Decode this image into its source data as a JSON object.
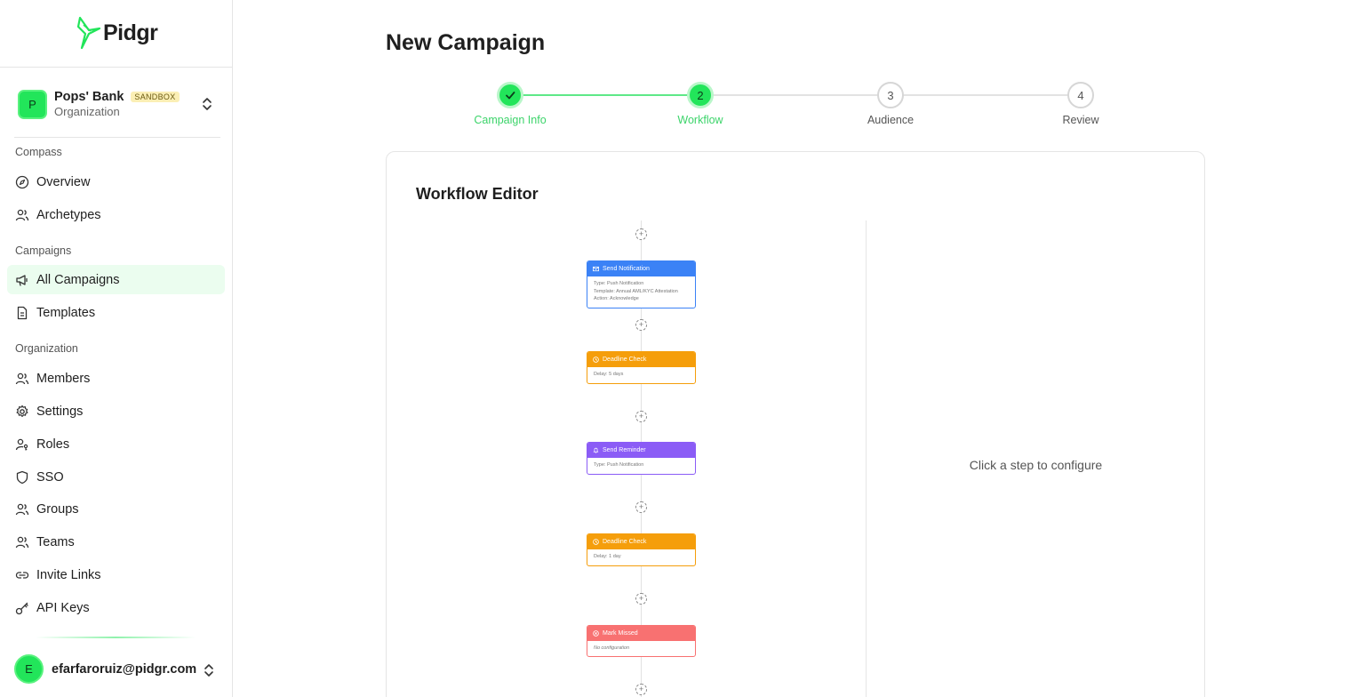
{
  "brand": {
    "name": "Pidgr",
    "accent": "#22e55a"
  },
  "org": {
    "avatar": "P",
    "name": "Pops' Bank",
    "badge": "SANDBOX",
    "type": "Organization"
  },
  "sidebar": {
    "compass_label": "Compass",
    "compass_items": [
      {
        "label": "Overview",
        "icon": "compass-icon"
      },
      {
        "label": "Archetypes",
        "icon": "users-icon"
      }
    ],
    "campaigns_label": "Campaigns",
    "campaign_items": [
      {
        "label": "All Campaigns",
        "icon": "megaphone-icon",
        "active": true
      },
      {
        "label": "Templates",
        "icon": "document-icon"
      }
    ],
    "organization_label": "Organization",
    "organization_items": [
      {
        "label": "Members",
        "icon": "users-icon"
      },
      {
        "label": "Settings",
        "icon": "gear-icon"
      },
      {
        "label": "Roles",
        "icon": "user-key-icon"
      },
      {
        "label": "SSO",
        "icon": "shield-icon"
      },
      {
        "label": "Groups",
        "icon": "users-icon"
      },
      {
        "label": "Teams",
        "icon": "users-icon"
      },
      {
        "label": "Invite Links",
        "icon": "link-icon"
      },
      {
        "label": "API Keys",
        "icon": "key-icon"
      }
    ]
  },
  "user": {
    "avatar": "E",
    "email": "efarfaroruiz@pidgr.com"
  },
  "page": {
    "title": "New Campaign"
  },
  "stepper": {
    "steps": [
      {
        "number": "1",
        "label": "Campaign Info",
        "state": "done"
      },
      {
        "number": "2",
        "label": "Workflow",
        "state": "current"
      },
      {
        "number": "3",
        "label": "Audience",
        "state": "todo"
      },
      {
        "number": "4",
        "label": "Review",
        "state": "todo"
      }
    ]
  },
  "editor": {
    "title": "Workflow Editor",
    "hint": "Click a step to configure",
    "nodes": [
      {
        "title": "Send Notification",
        "color": "#3b82f6",
        "icon": "notification-icon",
        "lines": [
          "Type: Push Notification",
          "Template: Annual AML/KYC Attestation",
          "Action: Acknowledge"
        ]
      },
      {
        "title": "Deadline Check",
        "color": "#f59e0b",
        "icon": "clock-icon",
        "lines": [
          "Delay: 5 days"
        ]
      },
      {
        "title": "Send Reminder",
        "color": "#8b5cf6",
        "icon": "bell-icon",
        "lines": [
          "Type: Push Notification"
        ]
      },
      {
        "title": "Deadline Check",
        "color": "#f59e0b",
        "icon": "clock-icon",
        "lines": [
          "Delay: 1 day"
        ]
      },
      {
        "title": "Mark Missed",
        "color": "#f87171",
        "icon": "x-circle-icon",
        "lines": [
          "No configuration"
        ]
      }
    ]
  }
}
